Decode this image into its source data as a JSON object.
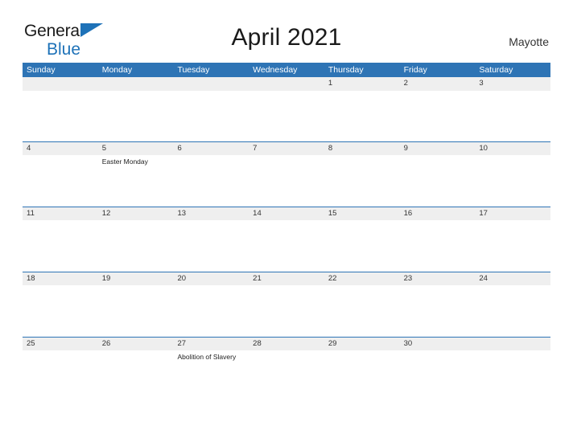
{
  "brand": {
    "name_part1": "General",
    "name_part2": "Blue",
    "flag_icon": "blue-triangle-flag"
  },
  "header": {
    "title": "April 2021",
    "location": "Mayotte"
  },
  "colors": {
    "header_blue": "#2e74b5",
    "band_gray": "#efefef",
    "brand_blue": "#1e72b8",
    "text": "#333333",
    "page_background": "#ffffff"
  },
  "calendar": {
    "month": "April",
    "year": "2021",
    "weekday_headers": [
      "Sunday",
      "Monday",
      "Tuesday",
      "Wednesday",
      "Thursday",
      "Friday",
      "Saturday"
    ],
    "weeks": [
      [
        {
          "date": "",
          "events": []
        },
        {
          "date": "",
          "events": []
        },
        {
          "date": "",
          "events": []
        },
        {
          "date": "",
          "events": []
        },
        {
          "date": "1",
          "events": []
        },
        {
          "date": "2",
          "events": []
        },
        {
          "date": "3",
          "events": []
        }
      ],
      [
        {
          "date": "4",
          "events": []
        },
        {
          "date": "5",
          "events": [
            "Easter Monday"
          ]
        },
        {
          "date": "6",
          "events": []
        },
        {
          "date": "7",
          "events": []
        },
        {
          "date": "8",
          "events": []
        },
        {
          "date": "9",
          "events": []
        },
        {
          "date": "10",
          "events": []
        }
      ],
      [
        {
          "date": "11",
          "events": []
        },
        {
          "date": "12",
          "events": []
        },
        {
          "date": "13",
          "events": []
        },
        {
          "date": "14",
          "events": []
        },
        {
          "date": "15",
          "events": []
        },
        {
          "date": "16",
          "events": []
        },
        {
          "date": "17",
          "events": []
        }
      ],
      [
        {
          "date": "18",
          "events": []
        },
        {
          "date": "19",
          "events": []
        },
        {
          "date": "20",
          "events": []
        },
        {
          "date": "21",
          "events": []
        },
        {
          "date": "22",
          "events": []
        },
        {
          "date": "23",
          "events": []
        },
        {
          "date": "24",
          "events": []
        }
      ],
      [
        {
          "date": "25",
          "events": []
        },
        {
          "date": "26",
          "events": []
        },
        {
          "date": "27",
          "events": [
            "Abolition of Slavery"
          ]
        },
        {
          "date": "28",
          "events": []
        },
        {
          "date": "29",
          "events": []
        },
        {
          "date": "30",
          "events": []
        },
        {
          "date": "",
          "events": []
        }
      ]
    ]
  }
}
